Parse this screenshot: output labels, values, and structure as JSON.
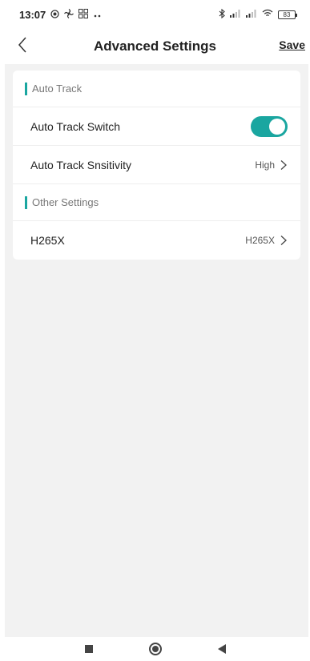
{
  "status_bar": {
    "time": "13:07",
    "left_icons": [
      "location-icon",
      "fan-icon",
      "grid-icon",
      "more-dots-icon"
    ],
    "right_icons": [
      "bluetooth-icon",
      "signal-icon",
      "signal-icon",
      "wifi-icon"
    ],
    "battery": "83"
  },
  "header": {
    "title": "Advanced Settings",
    "save_label": "Save"
  },
  "sections": {
    "auto_track": {
      "label": "Auto Track",
      "switch_label": "Auto Track Switch",
      "switch_on": true,
      "sensitivity_label": "Auto Track Snsitivity",
      "sensitivity_value": "High"
    },
    "other": {
      "label": "Other Settings",
      "h265_label": "H265X",
      "h265_value": "H265X"
    }
  },
  "colors": {
    "accent": "#1aa6a0",
    "background": "#f2f2f2",
    "card": "#ffffff"
  }
}
